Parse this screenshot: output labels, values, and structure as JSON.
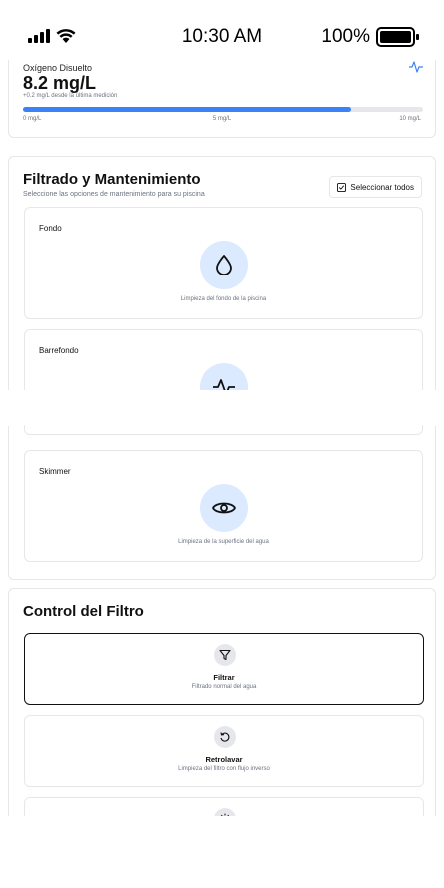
{
  "status_bar": {
    "time": "10:30 AM",
    "battery": "100%"
  },
  "metric": {
    "label": "Oxígeno Disuelto",
    "value": "8.2 mg/L",
    "delta": "+0.2 mg/L desde la última medición",
    "progress_fraction": 0.82,
    "scale": [
      "0 mg/L",
      "5 mg/L",
      "10 mg/L"
    ]
  },
  "maintenance": {
    "title": "Filtrado y Mantenimiento",
    "subtitle": "Seleccione las opciones de mantenimiento para su piscina",
    "select_all_label": "Seleccionar todos",
    "options": [
      {
        "title": "Fondo",
        "description": "Limpieza del fondo de la piscina",
        "icon": "droplet-icon"
      },
      {
        "title": "Barrefondo",
        "description": "",
        "icon": "pulse-icon"
      },
      {
        "title": "Skimmer",
        "description": "Limpieza de la superficie del agua",
        "icon": "eye-icon"
      }
    ]
  },
  "filter_control": {
    "title": "Control del Filtro",
    "options": [
      {
        "title": "Filtrar",
        "description": "Filtrado normal del agua",
        "icon": "filter-icon",
        "selected": true
      },
      {
        "title": "Retrolavar",
        "description": "Limpieza del filtro con flujo inverso",
        "icon": "rotate-ccw-icon",
        "selected": false
      }
    ]
  },
  "colors": {
    "accent": "#3b82f6",
    "icon_bg": "#dbeafe",
    "border": "#e5e7eb",
    "muted_text": "#6b7280"
  }
}
